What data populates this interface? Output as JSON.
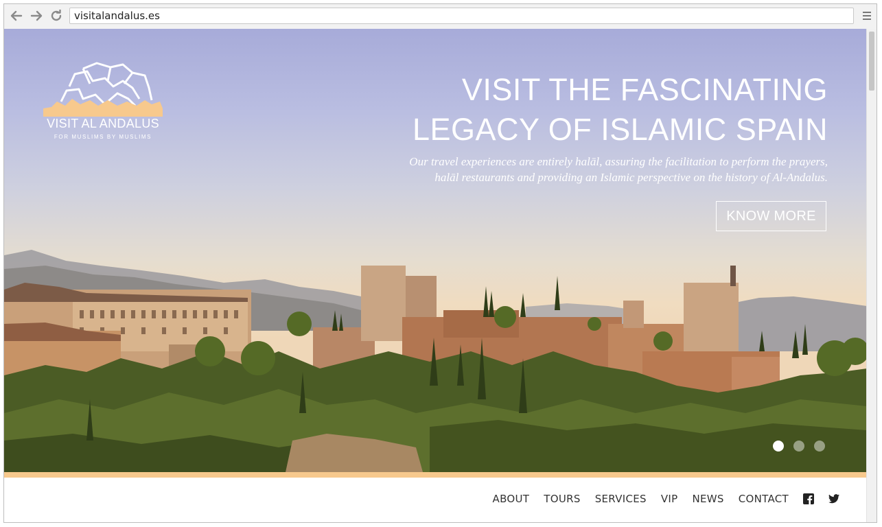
{
  "browser": {
    "url": "visitalandalus.es",
    "back_icon": "arrow-left-icon",
    "forward_icon": "arrow-right-icon",
    "reload_icon": "reload-icon",
    "menu_icon": "hamburger-menu-icon"
  },
  "brand": {
    "name": "VISIT AL ANDALUS",
    "tagline": "FOR MUSLIMS BY MUSLIMS",
    "accent_color": "#f7c98d"
  },
  "hero": {
    "title_line1": "VISIT THE FASCINATING",
    "title_line2": "LEGACY OF ISLAMIC SPAIN",
    "subtitle_line1": "Our travel experiences are entirely halāl, assuring the facilitation to perform the prayers,",
    "subtitle_line2": "halāl restaurants and providing an Islamic perspective on the history of Al-Andalus.",
    "cta_label": "KNOW MORE",
    "slides_total": 3,
    "active_slide": 1
  },
  "nav": {
    "items": [
      "ABOUT",
      "TOURS",
      "SERVICES",
      "VIP",
      "NEWS",
      "CONTACT"
    ],
    "social": [
      "facebook-icon",
      "twitter-icon"
    ]
  }
}
